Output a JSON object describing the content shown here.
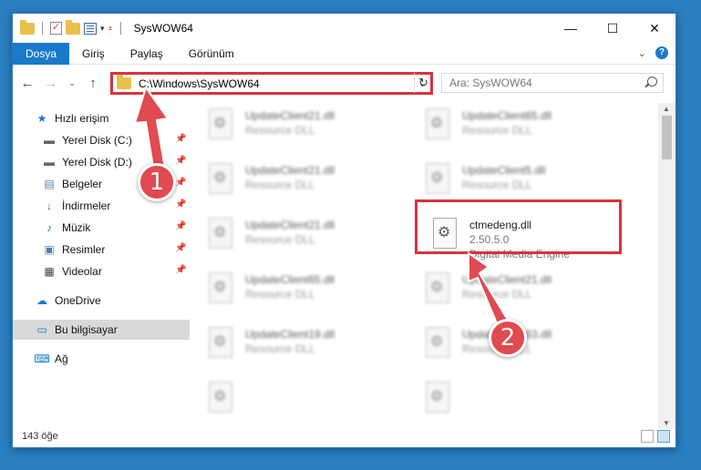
{
  "window": {
    "title": "SysWOW64"
  },
  "ribbon": {
    "tabs": [
      "Dosya",
      "Giriş",
      "Paylaş",
      "Görünüm"
    ]
  },
  "window_controls": {
    "minimize": "—",
    "maximize": "☐",
    "close": "✕"
  },
  "address": {
    "path": "C:\\Windows\\SysWOW64"
  },
  "search": {
    "placeholder": "Ara: SysWOW64"
  },
  "sidebar": {
    "items": [
      {
        "label": "Hızlı erişim",
        "icon": "star-icon"
      },
      {
        "label": "Yerel Disk (C:)",
        "icon": "drive-icon",
        "pinned": true
      },
      {
        "label": "Yerel Disk (D:)",
        "icon": "drive-icon",
        "pinned": true
      },
      {
        "label": "Belgeler",
        "icon": "documents-icon",
        "pinned": true
      },
      {
        "label": "İndirmeler",
        "icon": "download-icon",
        "pinned": true
      },
      {
        "label": "Müzik",
        "icon": "music-icon",
        "pinned": true
      },
      {
        "label": "Resimler",
        "icon": "pictures-icon",
        "pinned": true
      },
      {
        "label": "Videolar",
        "icon": "videos-icon",
        "pinned": true
      },
      {
        "label": "OneDrive",
        "icon": "cloud-icon"
      },
      {
        "label": "Bu bilgisayar",
        "icon": "computer-icon",
        "selected": true
      },
      {
        "label": "Ağ",
        "icon": "network-icon"
      }
    ]
  },
  "files": [
    {
      "name": "UpdateClient21.dll",
      "sub": "Resource DLL"
    },
    {
      "name": "UpdateClient65.dll",
      "sub": "Resource DLL"
    },
    {
      "name": "UpdateClient21.dll",
      "sub": "Resource DLL"
    },
    {
      "name": "UpdateClient5.dll",
      "sub": "Resource DLL"
    },
    {
      "name": "UpdateClient21.dll",
      "sub": "Resource DLL"
    },
    {
      "name": "ctmedeng.dll",
      "sub": "2.50.5.0",
      "desc": "Digital Media Engine",
      "highlighted": true
    },
    {
      "name": "UpdateClient65.dll",
      "sub": "Resource DLL"
    },
    {
      "name": "UpdateClient21.dll",
      "sub": "Resource DLL"
    },
    {
      "name": "UpdateClient19.dll",
      "sub": "Resource DLL"
    },
    {
      "name": "UpdateClient63.dll",
      "sub": "Resource DLL"
    }
  ],
  "status": {
    "count": "143 öğe"
  },
  "annotations": {
    "badge1": "1",
    "badge2": "2",
    "accent": "#e04a50"
  }
}
